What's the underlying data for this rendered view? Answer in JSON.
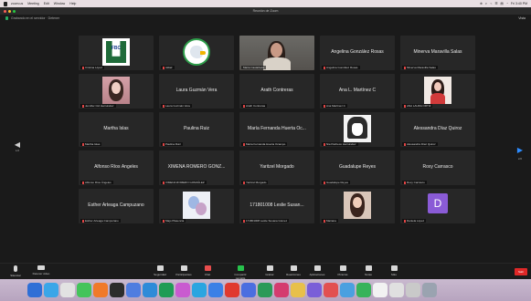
{
  "menubar": {
    "items": [
      "zoom.us",
      "Meeting",
      "Edit",
      "Window",
      "Help"
    ],
    "status": [
      "⊕",
      "◐",
      "⌁",
      "☰",
      "▤",
      "◔",
      "Fri 3:40 PM"
    ]
  },
  "window": {
    "title": "Reunión de Zoom"
  },
  "meeting_info": {
    "left": "Grabando en el servidor · Detener",
    "view": "Vista"
  },
  "tiles": [
    {
      "type": "logo-u",
      "logo_text": "FBC",
      "label": "Cristina López"
    },
    {
      "type": "logo-eagle",
      "label": "Aldair"
    },
    {
      "type": "video",
      "label": "María Castañeda"
    },
    {
      "type": "name",
      "name": "Angelina González Rosas",
      "label": "Angelina González Rosas"
    },
    {
      "type": "name",
      "name": "Minerva Maravilla Salas",
      "label": "Minerva Maravilla Salas"
    },
    {
      "type": "photo-girl",
      "label": "Jennifer Cid Hernández"
    },
    {
      "type": "name",
      "name": "Laura Guzmán Vera",
      "label": "Laura Guzmán Vera"
    },
    {
      "type": "name",
      "name": "Arath Contreras",
      "label": "Arath Contreras"
    },
    {
      "type": "name",
      "name": "Ana L. Martínez C",
      "label": "Ana Martínez C"
    },
    {
      "type": "photo-red",
      "label": "ANA LAURA ORTIZ"
    },
    {
      "type": "name",
      "name": "Martha Islas",
      "label": "Martha Islas"
    },
    {
      "type": "name",
      "name": "Paulina Ruiz",
      "label": "Paulina Ruiz"
    },
    {
      "type": "name",
      "name": "María Fernanda Huerta Oc...",
      "label": "María Fernanda Huerta Ocampo"
    },
    {
      "type": "manga",
      "label": "Nia Pacheco Hernández"
    },
    {
      "type": "name",
      "name": "Alessandra Díaz Quiroz",
      "label": "Alessandra Díaz Quiroz"
    },
    {
      "type": "name",
      "name": "Alfonso Ríos Ángeles",
      "label": "Alfonso Ríos Ángeles"
    },
    {
      "type": "name",
      "name": "XIMENA ROMERO GONZ...",
      "label": "XIMENA ROMERO GONZÁLEZ"
    },
    {
      "type": "name",
      "name": "Yaritzel Morgado",
      "label": "Yaritzel Morgado"
    },
    {
      "type": "name",
      "name": "Guadalupe Reyes",
      "label": "Guadalupe Reyes"
    },
    {
      "type": "name",
      "name": "Roxy Carrasco",
      "label": "Roxy Carrasco"
    },
    {
      "type": "name",
      "name": "Esther Arteaga Campuzano",
      "label": "Esther Arteaga Campuzano"
    },
    {
      "type": "sketch",
      "label": "Majo Plasencia"
    },
    {
      "type": "name",
      "name": "171801008 Leslie Susan...",
      "label": "171801008 Leslie Susana Gómez"
    },
    {
      "type": "photo-smile",
      "label": "Mariana"
    },
    {
      "type": "avatar",
      "initial": "D",
      "label": "Daniela López"
    }
  ],
  "toolbar": {
    "buttons": [
      {
        "label": "Silenciar",
        "icon": "microphone-icon"
      },
      {
        "label": "Detener video",
        "icon": "video-camera-icon"
      },
      {
        "label": "Seguridad",
        "icon": "shield-icon"
      },
      {
        "label": "Participantes",
        "icon": "participants-icon"
      },
      {
        "label": "Chat",
        "icon": "chat-icon"
      },
      {
        "label": "Compartir pantalla",
        "icon": "share-screen-icon"
      },
      {
        "label": "Grabar",
        "icon": "record-icon"
      },
      {
        "label": "Reacciones",
        "icon": "reactions-icon"
      },
      {
        "label": "Aplicaciones",
        "icon": "apps-icon"
      },
      {
        "label": "Pizarras",
        "icon": "whiteboard-icon"
      },
      {
        "label": "Notas",
        "icon": "notes-icon"
      },
      {
        "label": "Más",
        "icon": "more-icon"
      }
    ],
    "end_label": "Salir"
  },
  "nav": {
    "prev_page": "1/2",
    "next_page": "2/2"
  },
  "dock": {
    "colors": [
      "#2f6fd6",
      "#3aa6e8",
      "#e2e2e2",
      "#44c45b",
      "#f07a2a",
      "#2c2c2c",
      "#4f7de0",
      "#2e8bd8",
      "#1f9c55",
      "#c95bd0",
      "#2aa5e0",
      "#3b80e6",
      "#e0392f",
      "#4b6ee0",
      "#2b9a58",
      "#d43c6f",
      "#e8c04a",
      "#7a5fd8",
      "#e25050",
      "#4aa0e0",
      "#38b35a",
      "#f2f2f2",
      "#e0e0e0",
      "#c9c9c9",
      "#9aa3b0"
    ]
  }
}
